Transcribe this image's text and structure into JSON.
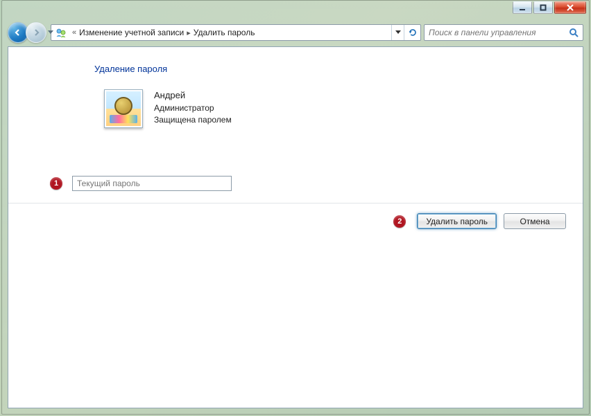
{
  "window_controls": {
    "minimize": "minimize",
    "maximize": "maximize",
    "close": "close"
  },
  "breadcrumb": {
    "prefix": "«",
    "items": [
      "Изменение учетной записи",
      "Удалить пароль"
    ]
  },
  "search": {
    "placeholder": "Поиск в панели управления"
  },
  "page": {
    "title": "Удаление пароля"
  },
  "account": {
    "name": "Андрей",
    "role": "Администратор",
    "status": "Защищена паролем"
  },
  "callouts": {
    "one": "1",
    "two": "2"
  },
  "password_input": {
    "placeholder": "Текущий пароль"
  },
  "buttons": {
    "remove": "Удалить пароль",
    "cancel": "Отмена"
  }
}
